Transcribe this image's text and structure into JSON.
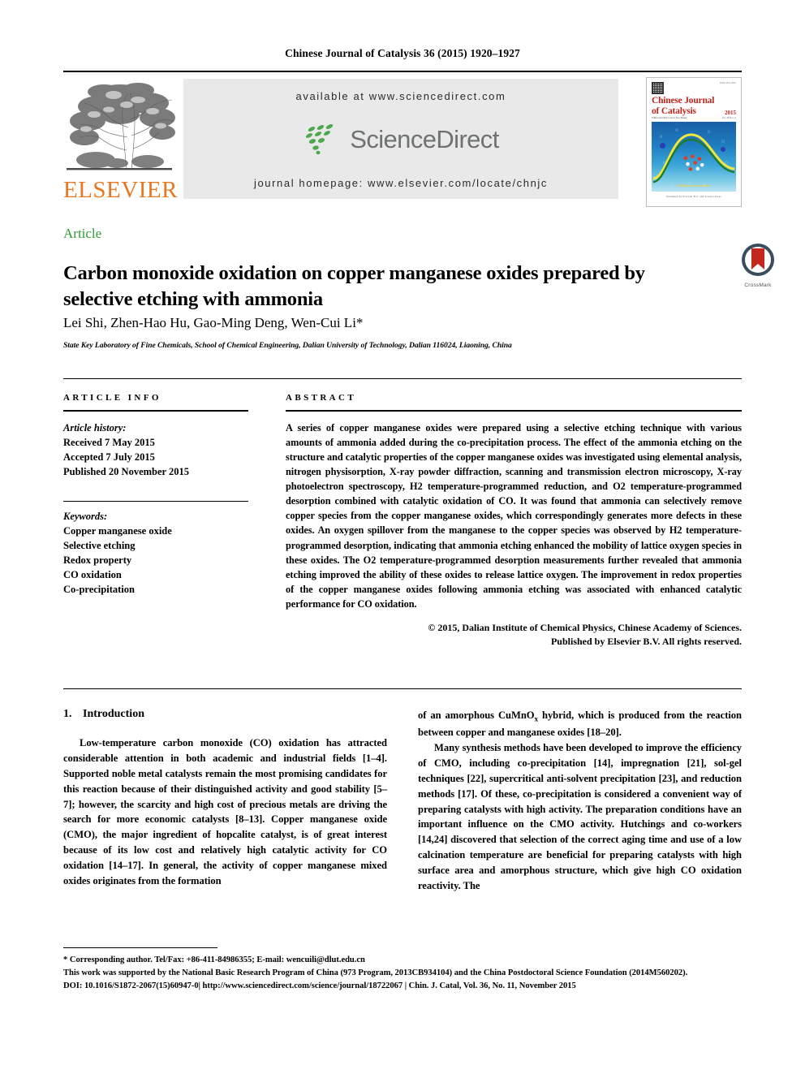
{
  "running_head": "Chinese Journal of Catalysis 36 (2015) 1920–1927",
  "masthead": {
    "publisher_wordmark": "ELSEVIER",
    "available_at": "available at www.sciencedirect.com",
    "sciencedirect_wordmark": "ScienceDirect",
    "journal_homepage": "journal homepage: www.elsevier.com/locate/chnjc",
    "cover": {
      "title_line1": "Chinese Journal",
      "title_line2": "of Catalysis",
      "editors": "Editor-in-Chief    Can Li   Tao Zhang",
      "year": "2015",
      "issue": "Vol. 36  No. 11",
      "top_right_note": "ISSN 1872-2067",
      "art_caption": "Hybrid precursor method",
      "footer": "Published by Elsevier B.V. and Science Press"
    }
  },
  "article": {
    "type_label": "Article",
    "title": "Carbon monoxide oxidation on copper manganese oxides prepared by selective etching with ammonia",
    "authors": "Lei Shi, Zhen-Hao Hu, Gao-Ming Deng, Wen-Cui Li*",
    "affiliation": "State Key Laboratory of Fine Chemicals, School of Chemical Engineering, Dalian University of Technology, Dalian 116024, Liaoning, China",
    "crossmark_label": "CrossMark"
  },
  "info": {
    "heading": "ARTICLE INFO",
    "history_title": "Article history:",
    "history": [
      "Received 7 May 2015",
      "Accepted 7 July 2015",
      "Published 20 November 2015"
    ],
    "keywords_title": "Keywords:",
    "keywords": [
      "Copper manganese oxide",
      "Selective etching",
      "Redox property",
      "CO oxidation",
      "Co-precipitation"
    ]
  },
  "abstract": {
    "heading": "ABSTRACT",
    "paragraphs": [
      "A series of copper manganese oxides were prepared using a selective etching technique with various amounts of ammonia added during the co-precipitation process. The effect of the ammonia etching on the structure and catalytic properties of the copper manganese oxides was investigated using elemental analysis, nitrogen physisorption, X-ray powder diffraction, scanning and transmission electron microscopy, X-ray photoelectron spectroscopy, H2 temperature-programmed reduction, and O2 temperature-programmed desorption combined with catalytic oxidation of CO. It was found that ammonia can selectively remove copper species from the copper manganese oxides, which correspondingly generates more defects in these oxides. An oxygen spillover from the manganese to the copper species was observed by H2 temperature-programmed desorption, indicating that ammonia etching enhanced the mobility of lattice oxygen species in these oxides. The O2 temperature-programmed desorption measurements further revealed that ammonia etching improved the ability of these oxides to release lattice oxygen. The improvement in redox properties of the copper manganese oxides following ammonia etching was associated with enhanced catalytic performance for CO oxidation."
    ],
    "copyright_line1": "© 2015, Dalian Institute of Chemical Physics, Chinese Academy of Sciences.",
    "copyright_line2": "Published by Elsevier B.V. All rights reserved."
  },
  "body": {
    "section_number": "1.",
    "section_title": "Introduction",
    "left_column_paragraph": "Low-temperature carbon monoxide (CO) oxidation has attracted considerable attention in both academic and industrial fields [1–4]. Supported noble metal catalysts remain the most promising candidates for this reaction because of their distinguished activity and good stability [5–7]; however, the scarcity and high cost of precious metals are driving the search for more economic catalysts [8–13]. Copper manganese oxide (CMO), the major ingredient of hopcalite catalyst, is of great interest because of its low cost and relatively high catalytic activity for CO oxidation [14–17]. In general, the activity of copper manganese mixed oxides originates from the formation",
    "right_column_paragraph_1_pre": "of an amorphous CuMnO",
    "right_column_paragraph_1_sub": "x",
    "right_column_paragraph_1_post": " hybrid, which is produced from the reaction between copper and manganese oxides [18–20].",
    "right_column_paragraph_2": "Many synthesis methods have been developed to improve the efficiency of CMO, including co-precipitation [14], impregnation [21], sol-gel techniques [22], supercritical anti-solvent precipitation [23], and reduction methods [17]. Of these, co-precipitation is considered a convenient way of preparing catalysts with high activity. The preparation conditions have an important influence on the CMO activity. Hutchings and co-workers [14,24] discovered that selection of the correct aging time and use of a low calcination temperature are beneficial for preparing catalysts with high surface area and amorphous structure, which give high CO oxidation reactivity. The"
  },
  "footnotes": {
    "corresponding": "* Corresponding author. Tel/Fax: +86-411-84986355; E-mail: wencuili@dlut.edu.cn",
    "funding": "This work was supported by the National Basic Research Program of China (973 Program, 2013CB934104) and the China Postdoctoral Science Foundation (2014M560202).",
    "doi": "DOI: 10.1016/S1872-2067(15)60947-0| http://www.sciencedirect.com/science/journal/18722067 | Chin. J. Catal, Vol. 36, No. 11, November 2015"
  },
  "colors": {
    "article_label_green": "#2E9E37",
    "elsevier_orange": "#E87722",
    "sciencedirect_green": "#4CA84C",
    "sciencedirect_gray": "#6E7372",
    "cover_red": "#C0261E",
    "crossmark_red": "#C4281C",
    "crossmark_blue": "#3A4B5C",
    "banner_gray": "#E9E9E9"
  }
}
